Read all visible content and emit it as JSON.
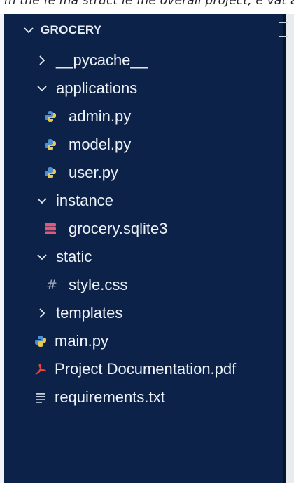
{
  "top_strip": {
    "text": "m the fe ma struct ie fhe overall project, e vat are to fin"
  },
  "explorer": {
    "root_label": "GROCERY",
    "root_expanded": true,
    "items": [
      {
        "label": "__pycache__",
        "type": "folder",
        "expanded": false,
        "icon": "chevron-right-icon"
      },
      {
        "label": "applications",
        "type": "folder",
        "expanded": true,
        "icon": "chevron-down-icon"
      },
      {
        "label": "admin.py",
        "type": "file",
        "icon": "python-icon"
      },
      {
        "label": "model.py",
        "type": "file",
        "icon": "python-icon"
      },
      {
        "label": "user.py",
        "type": "file",
        "icon": "python-icon"
      },
      {
        "label": "instance",
        "type": "folder",
        "expanded": true,
        "icon": "chevron-down-icon"
      },
      {
        "label": "grocery.sqlite3",
        "type": "file",
        "icon": "database-icon"
      },
      {
        "label": "static",
        "type": "folder",
        "expanded": true,
        "icon": "chevron-down-icon"
      },
      {
        "label": "style.css",
        "type": "file",
        "icon": "hash-icon"
      },
      {
        "label": "templates",
        "type": "folder",
        "expanded": false,
        "icon": "chevron-right-icon"
      },
      {
        "label": "main.py",
        "type": "file",
        "icon": "python-icon"
      },
      {
        "label": "Project Documentation.pdf",
        "type": "file",
        "icon": "pdf-icon"
      },
      {
        "label": "requirements.txt",
        "type": "file",
        "icon": "text-lines-icon"
      }
    ]
  },
  "colors": {
    "panel_bg": "#0c2249",
    "text": "#eef2f8",
    "python_blue": "#4f8fd0",
    "python_yellow": "#e6c94d",
    "database_red": "#e05a79",
    "pdf_red": "#e8453c",
    "hash_gray": "#9aa7b8"
  }
}
